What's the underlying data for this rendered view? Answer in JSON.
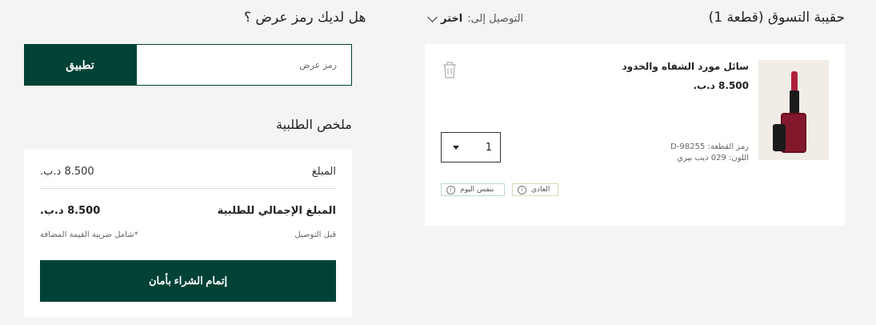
{
  "bag": {
    "title": "حقيبة التسوق (قطعة 1)",
    "deliver_label": "التوصيل إلى:",
    "deliver_choice": "اختر",
    "item": {
      "name": "سائل مورد الشفاه والخدود",
      "price": "8.500 د.ب.",
      "code": "رمز القطعة: D-98255",
      "color": "اللون: 029 ديب بيري",
      "quantity": "1",
      "ship_regular": "العادي",
      "ship_sameday": "بنفس اليوم"
    }
  },
  "promo": {
    "title": "هل لديك رمز عرض ؟",
    "placeholder": "رمز عرض",
    "apply_label": "تطبيق"
  },
  "summary": {
    "title": "ملخص الطلبية",
    "amount_label": "المبلغ",
    "amount_value": "8.500 د.ب.",
    "total_label": "المبلغ الإجمالي للطلبية",
    "total_value": "8.500 د.ب.",
    "before_delivery": "قبل التوصيل",
    "vat_note": "*شامل ضريبة القيمة المضافة",
    "checkout_label": "إتمام الشراء بأمان"
  },
  "colors": {
    "brand": "#004236"
  }
}
